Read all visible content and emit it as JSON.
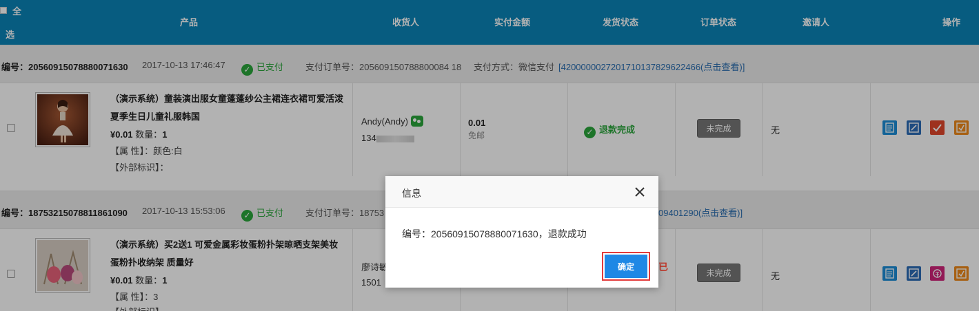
{
  "header": {
    "select_all_1": "全",
    "select_all_2": "选",
    "product": "产品",
    "receiver": "收货人",
    "amount": "实付金额",
    "ship_status": "发货状态",
    "order_status": "订单状态",
    "inviter": "邀请人",
    "actions": "操作"
  },
  "orders": [
    {
      "number_label": "编号：",
      "number": "20560915078880071630",
      "time": "2017-10-13 17:46:47",
      "pay_status": "已支付",
      "pay_order_label": "支付订单号：",
      "pay_order_no": "205609150788800084 18",
      "pay_method_label": "支付方式：微信支付",
      "txn_link": "[4200000027201710137829622466(点击查看)]",
      "product_name": "（演示系统）童装演出服女童蓬蓬纱公主裙连衣裙可爱活泼夏季生日儿童礼服韩国",
      "price": "¥0.01",
      "qty_label": "数量：",
      "qty": "1",
      "attr": "【属 性】：颜色:白",
      "ext": "【外部标识】：",
      "receiver": "Andy(Andy)",
      "phone_prefix": "134",
      "phone_suffix": "",
      "amount": "0.01",
      "shipping": "免邮",
      "ship_state": "退款完成",
      "order_state": "未完成",
      "inviter": "无"
    },
    {
      "number_label": "编号：",
      "number": "18753215078811861090",
      "time": "2017-10-13 15:53:06",
      "pay_status": "已支付",
      "pay_order_label": "支付订单号：",
      "pay_order_no": "18753",
      "txn_link_tail": "09401290(点击查看)]",
      "product_name": "（演示系统）买2送1 可爱金属彩妆蛋粉扑架晾晒支架美妆蛋粉扑收纳架 质量好",
      "price": "¥0.01",
      "qty_label": "数量：",
      "qty": "1",
      "attr": "【属 性】：3",
      "ext": "【外部标识】",
      "receiver": "廖诗敏",
      "phone": "1501",
      "ship_peek": "已",
      "order_state": "未完成",
      "inviter": "无"
    }
  ],
  "dialog": {
    "title": "信息",
    "message": "编号：20560915078880071630，退款成功",
    "ok": "确定"
  },
  "colors": {
    "header_bg": "#0b84b8",
    "success": "#2aa63b",
    "primary": "#1e88e5",
    "highlight": "#e23b3b"
  }
}
